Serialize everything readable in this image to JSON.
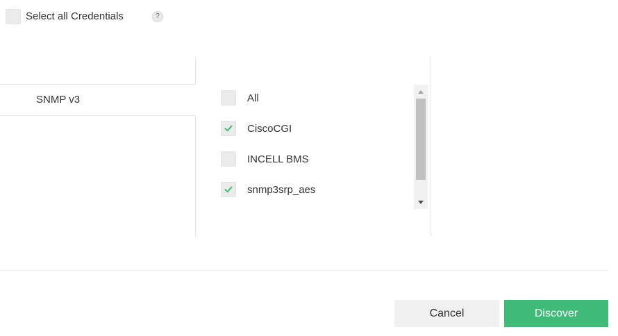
{
  "select_all": {
    "label": "Select all Credentials",
    "checked": false,
    "help_symbol": "?"
  },
  "protocols": [
    {
      "label": "SNMP v3",
      "selected": true
    }
  ],
  "credentials": [
    {
      "label": "All",
      "checked": false
    },
    {
      "label": "CiscoCGI",
      "checked": true
    },
    {
      "label": "INCELL BMS",
      "checked": false
    },
    {
      "label": "snmp3srp_aes",
      "checked": true
    }
  ],
  "icons": {
    "check": "checkmark-icon",
    "help": "help-icon",
    "scroll_up": "scroll-up-arrow-icon",
    "scroll_down": "scroll-down-arrow-icon"
  },
  "colors": {
    "check": "#3fbb77",
    "primary_button": "#3fbb77",
    "secondary_button": "#f0f0f0"
  },
  "buttons": {
    "cancel_label": "Cancel",
    "discover_label": "Discover"
  }
}
